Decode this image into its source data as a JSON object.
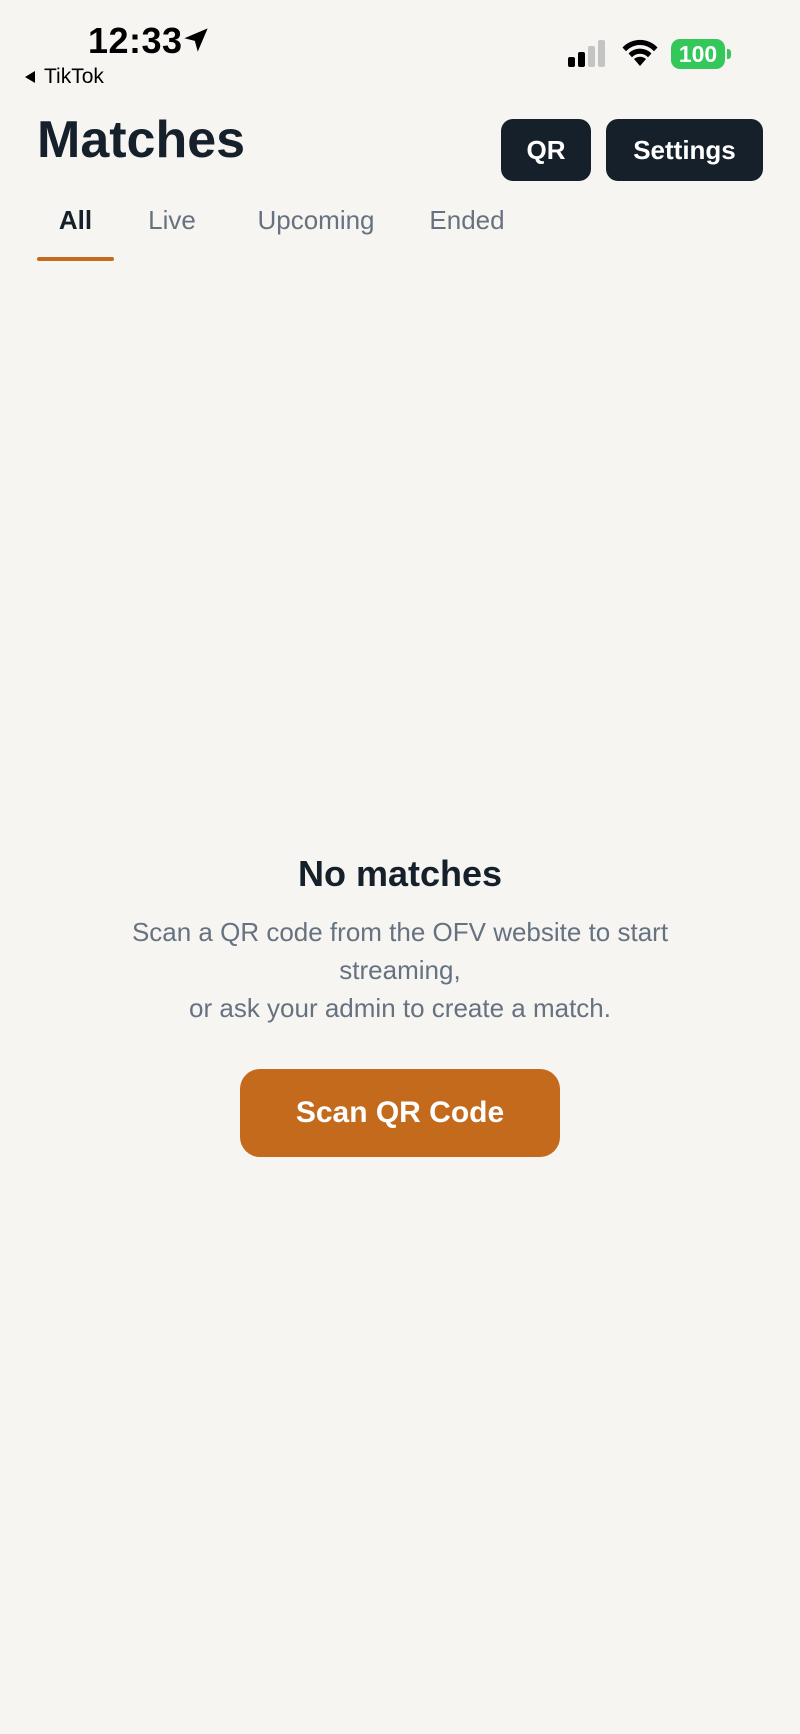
{
  "status_bar": {
    "time": "12:33",
    "back_app": "TikTok",
    "battery": "100",
    "battery_color": "#34c759"
  },
  "header": {
    "title": "Matches",
    "qr_label": "QR",
    "settings_label": "Settings"
  },
  "tabs": [
    {
      "label": "All",
      "active": true
    },
    {
      "label": "Live",
      "active": false
    },
    {
      "label": "Upcoming",
      "active": false
    },
    {
      "label": "Ended",
      "active": false
    }
  ],
  "empty_state": {
    "title": "No matches",
    "desc_line1": "Scan a QR code from the OFV website to start streaming,",
    "desc_line2": "or ask your admin to create a match.",
    "button_label": "Scan QR Code"
  },
  "colors": {
    "accent": "#c46a1c",
    "dark": "#15202b",
    "muted": "#677281",
    "background": "#f6f5f2"
  },
  "icons": {
    "location": "location-arrow-icon",
    "signal": "cellular-signal-icon",
    "wifi": "wifi-icon",
    "back": "back-triangle-icon"
  }
}
